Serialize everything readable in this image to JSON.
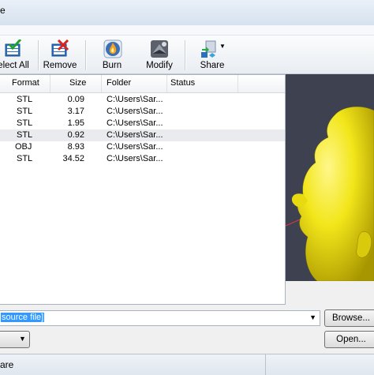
{
  "window": {
    "title_fragment": "e"
  },
  "toolbar": {
    "buttons": [
      {
        "label": "elect All",
        "icon": "select-all-icon"
      },
      {
        "label": "Remove",
        "icon": "remove-icon"
      },
      {
        "label": "Burn",
        "icon": "burn-icon"
      },
      {
        "label": "Modify",
        "icon": "modify-icon"
      },
      {
        "label": "Share",
        "icon": "share-icon"
      }
    ]
  },
  "file_list": {
    "columns": [
      "Format",
      "Size",
      "Folder",
      "Status"
    ],
    "rows": [
      {
        "format": "STL",
        "size": "0.09",
        "folder": "C:\\Users\\Sar...",
        "status": ""
      },
      {
        "format": "STL",
        "size": "3.17",
        "folder": "C:\\Users\\Sar...",
        "status": ""
      },
      {
        "format": "STL",
        "size": "1.95",
        "folder": "C:\\Users\\Sar...",
        "status": ""
      },
      {
        "format": "STL",
        "size": "0.92",
        "folder": "C:\\Users\\Sar...",
        "status": "",
        "selected": true
      },
      {
        "format": "OBJ",
        "size": "8.93",
        "folder": "C:\\Users\\Sar...",
        "status": ""
      },
      {
        "format": "STL",
        "size": "34.52",
        "folder": "C:\\Users\\Sar...",
        "status": ""
      }
    ]
  },
  "viewer": {
    "model_color": "#f2e61a",
    "background": "#3e4250"
  },
  "source": {
    "value": "source file]"
  },
  "buttons": {
    "browse": "Browse...",
    "open": "Open..."
  },
  "statusbar": {
    "text": "are"
  }
}
